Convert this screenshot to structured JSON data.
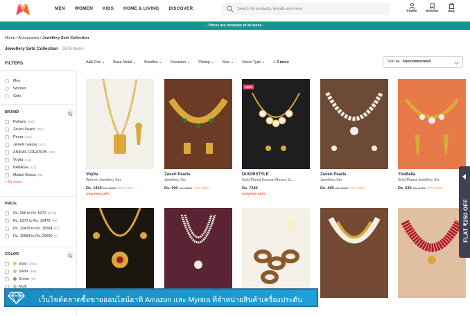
{
  "header": {
    "nav": [
      "MEN",
      "WOMEN",
      "KIDS",
      "HOME & LIVING",
      "DISCOVER"
    ],
    "search_placeholder": "Search for products, brands and more",
    "icons": [
      {
        "name": "profile-icon",
        "label": "Profile"
      },
      {
        "name": "wishlist-icon",
        "label": "Wishlist"
      },
      {
        "name": "bag-icon",
        "label": "Bag"
      }
    ]
  },
  "banner": "- Prices are inclusive of all taxes -",
  "breadcrumb": {
    "home": "Home",
    "category": "Accessories",
    "current": "Jewellery Sets Collection",
    "sep": "/"
  },
  "page": {
    "title": "Jewellery Sets Collection",
    "count": "- 2876 items"
  },
  "filters": {
    "title": "FILTERS",
    "gender": [
      "Men",
      "Women",
      "Girls"
    ],
    "brand": {
      "title": "BRAND",
      "items": [
        {
          "label": "Rubans",
          "count": "(498)"
        },
        {
          "label": "Zaveri Pearls",
          "count": "(381)"
        },
        {
          "label": "Peora",
          "count": "(163)"
        },
        {
          "label": "Jewels Galaxy",
          "count": "(147)"
        },
        {
          "label": "ANIKAS CREATION",
          "count": "(136)"
        },
        {
          "label": "Voylla",
          "count": "(114)"
        },
        {
          "label": "PANASH",
          "count": "(111)"
        },
        {
          "label": "Malani Bonsa",
          "count": "(89)"
        }
      ],
      "more": "+ 61 more"
    },
    "price": {
      "title": "PRICE",
      "items": [
        {
          "label": "Rs. 266 to Rs. 5372",
          "count": "(2745)"
        },
        {
          "label": "Rs. 5372 to Rs. 10478",
          "count": "(98)"
        },
        {
          "label": "Rs. 10478 to Rs. 15584",
          "count": "(21)"
        },
        {
          "label": "Rs. 15584 to Rs. 20690",
          "count": "(8)"
        }
      ]
    },
    "color": {
      "title": "COLOR",
      "items": [
        {
          "label": "Gold",
          "count": "(1882)",
          "color": "#e5c74a"
        },
        {
          "label": "Silver",
          "count": "(338)",
          "color": "#c0c0c0"
        },
        {
          "label": "Green",
          "count": "(97)",
          "color": "#5eb160"
        },
        {
          "label": "Multi",
          "count": "",
          "color": "#a8d66f"
        }
      ]
    }
  },
  "filter_bar": [
    "Add-Ons",
    "Base Metal",
    "Bundles",
    "Occasion",
    "Plating",
    "Size",
    "Stone Type",
    "+ 3 more"
  ],
  "sort": {
    "label": "Sort by :",
    "value": "Recommended"
  },
  "products": [
    {
      "brand": "Voylla",
      "name": "Women Jewellery Set",
      "price": "Rs. 1439",
      "mrp": "Rs. 3599",
      "off": "(60% OFF)",
      "few": "Only Few Left!",
      "bg": "#f3f0ea"
    },
    {
      "brand": "Zaveri Pearls",
      "name": "Jewellery Set",
      "price": "Rs. 990",
      "mrp": "Rs. 3960",
      "off": "(75% OFF)",
      "few": "",
      "bg": "#6b3b25"
    },
    {
      "brand": "DUGRISTYLE",
      "name": "Gold-Plated Kundan Meena St...",
      "price": "Rs. 7280",
      "mrp": "",
      "off": "",
      "few": "Only Few Left!",
      "bg": "#1e1e20",
      "tag": "NEW"
    },
    {
      "brand": "Zaveri Pearls",
      "name": "Jewellery Set",
      "price": "Rs. 499",
      "mrp": "Rs. 1996",
      "off": "(75% OFF)",
      "few": "",
      "bg": "#6d4a36"
    },
    {
      "brand": "YouBella",
      "name": "Gold-Plated Jewellery Set",
      "price": "Rs. 539",
      "mrp": "Rs. 1799",
      "off": "(70% OFF)",
      "few": "",
      "bg": "#e77a48"
    },
    {
      "bg": "#1c1611"
    },
    {
      "bg": "#5b2334"
    },
    {
      "bg": "#f5f0e8"
    },
    {
      "bg": "#744a34"
    },
    {
      "bg": "#e0c0a0"
    }
  ],
  "side_tab": "FLAT ₹250 OFF",
  "overlay_text": "เว็บไซต์ตลาดซื้อขายออนไลน์อาทิ Amazon และ Myntra ที่จำหน่ายสินค้าเครื่องประดับ"
}
